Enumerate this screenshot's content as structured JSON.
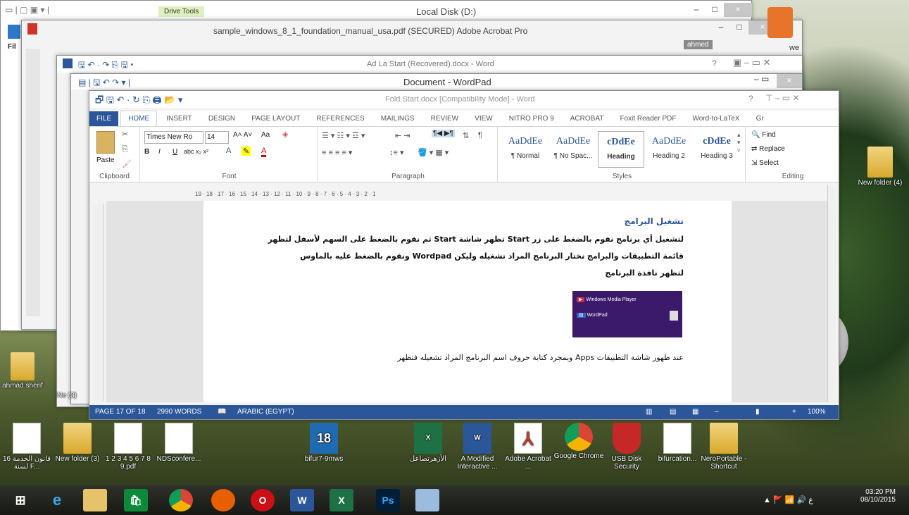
{
  "explorer_window": {
    "drive_tools": "Drive Tools",
    "title": "Local Disk (D:)",
    "side_tab": "Fil"
  },
  "acrobat_window": {
    "title": "sample_windows_8_1_foundation_manual_usa.pdf (SECURED)   Adobe Acrobat Pro",
    "user": "ahmed",
    "overflow_label": "we"
  },
  "word_back_window": {
    "title": "Ad La Start (Recovered).docx - Word",
    "help": "?"
  },
  "wordpad_window": {
    "title": "Document - WordPad"
  },
  "word_window": {
    "title": "Fold Start.docx [Compatibility Mode] - Word",
    "help": "?",
    "tabs": [
      "FILE",
      "HOME",
      "INSERT",
      "DESIGN",
      "PAGE LAYOUT",
      "REFERENCES",
      "MAILINGS",
      "REVIEW",
      "VIEW",
      "NITRO PRO 9",
      "ACROBAT",
      "Foxit Reader PDF",
      "Word-to-LaTeX",
      "Gr"
    ],
    "clipboard": {
      "paste": "Paste",
      "label": "Clipboard"
    },
    "font": {
      "name": "Times New Ro",
      "size": "14",
      "label": "Font",
      "case_btn": "Aa"
    },
    "paragraph": {
      "label": "Paragraph"
    },
    "styles": {
      "label": "Styles",
      "items": [
        {
          "sample": "AaDdEe",
          "name": "¶ Normal"
        },
        {
          "sample": "AaDdEe",
          "name": "¶ No Spac..."
        },
        {
          "sample": "cDdEe",
          "name": "Heading"
        },
        {
          "sample": "AaDdEe",
          "name": "Heading 2"
        },
        {
          "sample": "cDdEe",
          "name": "Heading 3"
        }
      ]
    },
    "editing": {
      "label": "Editing",
      "find": "Find",
      "replace": "Replace",
      "select": "Select"
    },
    "ruler": "19 · 18 · 17 · 16 · 15 · 14 · 13 · 12 · 11 · 10 · 9 · 8 · 7 · 6 · 5 · 4 · 3 · 2 · 1",
    "document": {
      "heading": "تشغيل البرامج",
      "line1": "لتشغيل أي برنامج نقوم بالضغط على زر Start تظهر شاشة Start ثم نقوم بالضغط على السهم لأسفل لتظهر",
      "line2": "قائمة التطبيقات والبرامج نختار البرنامج المراد تشغيله وليكن Wordpad ونقوم بالضغط عليه بالماوس",
      "line3": "لتظهر نافذة البرنامج",
      "image_row1": "Windows Media Player",
      "image_row2": "WordPad",
      "line4": "عند ظهور شاشة التطبيقات Apps وبمجرد كتابة حروف اسم البرنامج المراد تشغيله فتظهر"
    },
    "status": {
      "page": "PAGE 17 OF 18",
      "words": "2990 WORDS",
      "language": "ARABIC (EGYPT)",
      "zoom": "100%",
      "zoom_minus": "–",
      "zoom_plus": "+"
    }
  },
  "desktop_icons": [
    {
      "label": "قانون الخدمة 16 لسنة F...",
      "kind": "doc"
    },
    {
      "label": "New folder (3)",
      "kind": "folder"
    },
    {
      "label": "1 2 3 4 5 6 7 8 9.pdf",
      "kind": "doc"
    },
    {
      "label": "NDSconfere...",
      "kind": "doc"
    },
    {
      "label": "bifur7-9mws",
      "kind": "app18"
    },
    {
      "label": "الأزهرتصاعل",
      "kind": "excel"
    },
    {
      "label": "A Modified Interactive ...",
      "kind": "word"
    },
    {
      "label": "Adobe Acrobat ...",
      "kind": "acrobat"
    },
    {
      "label": "Google Chrome",
      "kind": "chrome"
    },
    {
      "label": "USB Disk Security",
      "kind": "usb"
    },
    {
      "label": "bifurcation...",
      "kind": "doc2"
    },
    {
      "label": "NeroPortable - Shortcut",
      "kind": "folder"
    }
  ],
  "left_icons": [
    {
      "label": "ahmad sherif"
    },
    {
      "label": "Ne (3)"
    }
  ],
  "right_icon": {
    "label": "New folder (4)"
  },
  "taskbar": {
    "apps": [
      "windows-start",
      "internet-explorer",
      "file-explorer",
      "store",
      "chrome",
      "firefox",
      "opera",
      "word",
      "excel",
      "photoshop",
      "paint"
    ],
    "time": "03:20 PM",
    "date": "08/10/2015"
  },
  "colors": {
    "word_blue": "#2b579a",
    "taskbar": "#1e1e1e"
  }
}
